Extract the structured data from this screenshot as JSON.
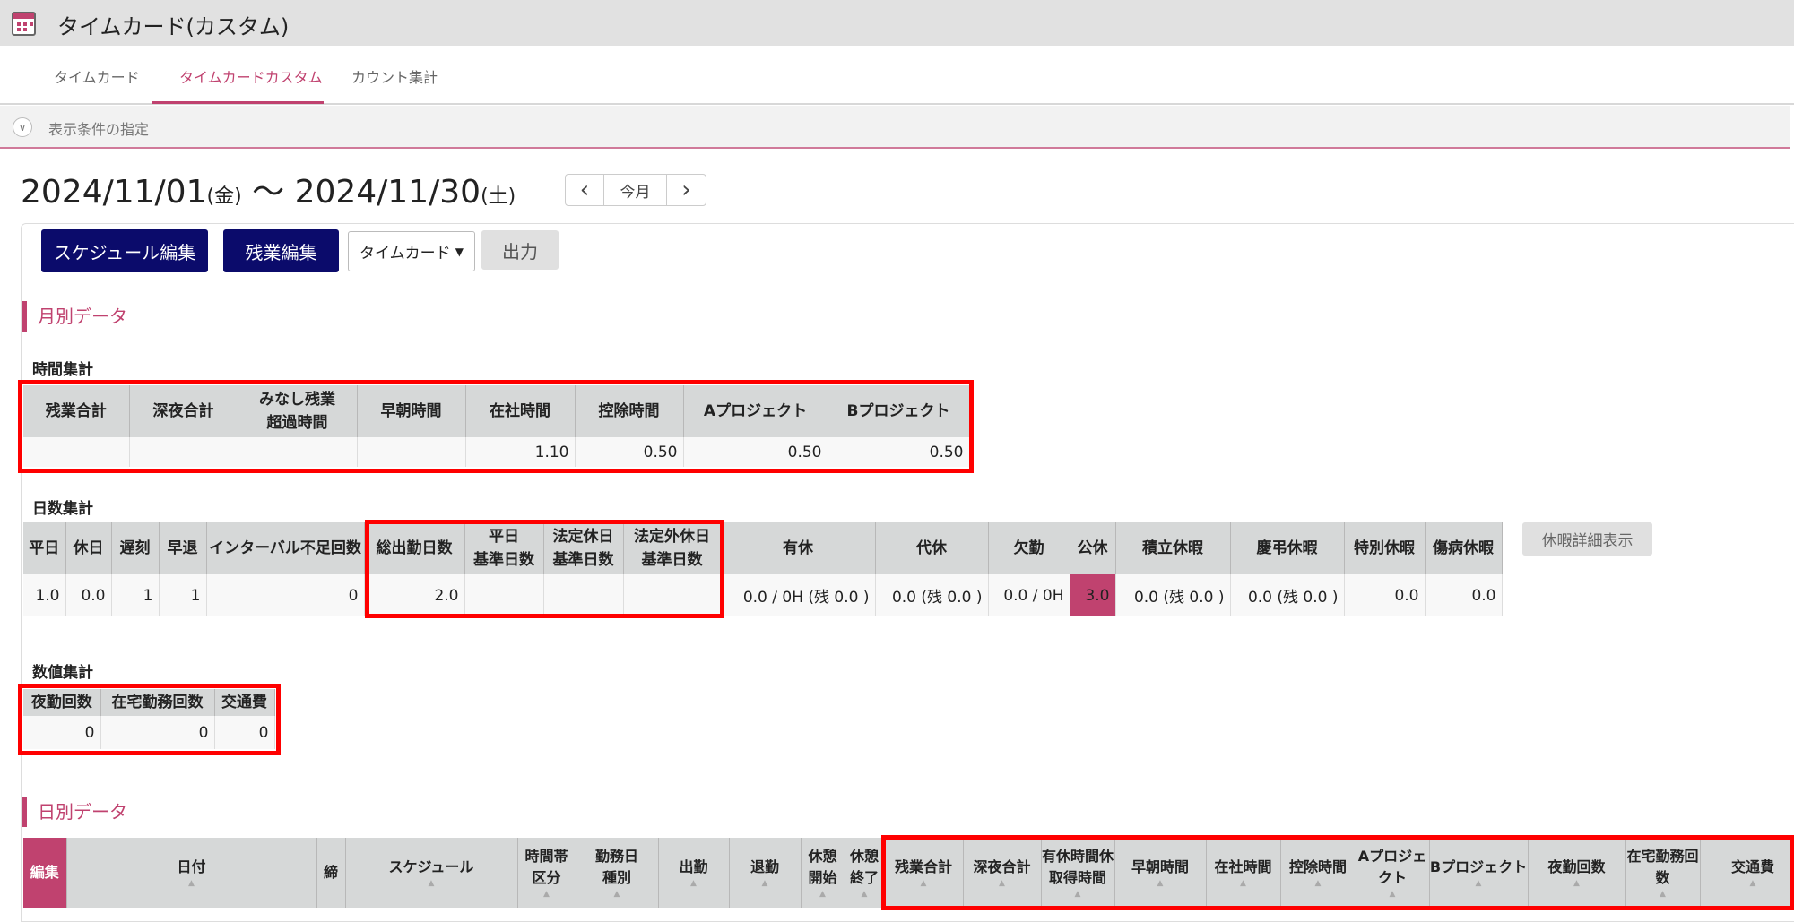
{
  "app": {
    "title": "タイムカード(カスタム)",
    "icon": "calendar-icon",
    "accent": "#c0426f",
    "navy": "#0b0b6b"
  },
  "tabs": [
    "タイムカード",
    "タイムカードカスタム",
    "カウント集計"
  ],
  "filter": {
    "label": "表示条件の指定"
  },
  "range": {
    "start": "2024/11/01",
    "start_day": "(金)",
    "sep": " ～ ",
    "end": "2024/11/30",
    "end_day": "(土)"
  },
  "nav": {
    "prev": "‹",
    "today": "今月",
    "next": "›"
  },
  "toolbar": {
    "schedule_edit": "スケジュール編集",
    "overtime_edit": "残業編集",
    "select_value": "タイムカード",
    "output": "出力"
  },
  "monthly": {
    "title": "月別データ",
    "time": {
      "title": "時間集計",
      "headers": [
        "残業合計",
        "深夜合計",
        "みなし残業\n超過時間",
        "早朝時間",
        "在社時間",
        "控除時間",
        "Aプロジェクト",
        "Bプロジェクト"
      ],
      "values": [
        "",
        "",
        "",
        "",
        "1.10",
        "0.50",
        "0.50",
        "0.50"
      ]
    },
    "days": {
      "title": "日数集計",
      "headers": [
        "平日",
        "休日",
        "遅刻",
        "早退",
        "インターバル不足回数",
        "総出勤日数",
        "平日\n基準日数",
        "法定休日\n基準日数",
        "法定外休日\n基準日数",
        "有休",
        "代休",
        "欠勤",
        "公休",
        "積立休暇",
        "慶弔休暇",
        "特別休暇",
        "傷病休暇"
      ],
      "values": [
        "1.0",
        "0.0",
        "1",
        "1",
        "0",
        "2.0",
        "",
        "",
        "",
        "0.0 / 0H (残 0.0 )",
        "0.0 (残 0.0 )",
        "0.0 / 0H",
        "3.0",
        "0.0 (残 0.0 )",
        "0.0 (残 0.0 )",
        "0.0",
        "0.0"
      ],
      "detail_button": "休暇詳細表示"
    },
    "counts": {
      "title": "数値集計",
      "headers": [
        "夜勤回数",
        "在宅勤務回数",
        "交通費"
      ],
      "values": [
        "0",
        "0",
        "0"
      ]
    }
  },
  "daily": {
    "title": "日別データ",
    "headers": [
      "編集",
      "日付",
      "締",
      "スケジュール",
      "時間帯\n区分",
      "勤務日\n種別",
      "出勤",
      "退勤",
      "休憩\n開始",
      "休憩\n終了",
      "残業合計",
      "深夜合計",
      "有休時間休\n取得時間",
      "早朝時間",
      "在社時間",
      "控除時間",
      "Aプロジェクト",
      "Bプロジェクト",
      "夜勤回数",
      "在宅勤務回数",
      "交通費"
    ]
  }
}
